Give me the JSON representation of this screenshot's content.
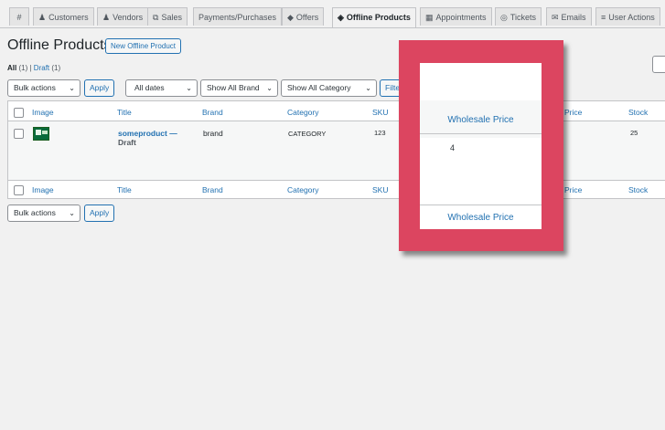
{
  "tabs": [
    {
      "icon": "#",
      "label": ""
    },
    {
      "icon": "♟",
      "label": "Customers"
    },
    {
      "icon": "♟",
      "label": "Vendors"
    },
    {
      "icon": "⧉",
      "label": "Sales"
    },
    {
      "icon": "",
      "label": "Payments/Purchases"
    },
    {
      "icon": "◆",
      "label": "Offers"
    },
    {
      "icon": "◈",
      "label": "Offline Products"
    },
    {
      "icon": "▦",
      "label": "Appointments"
    },
    {
      "icon": "◎",
      "label": "Tickets"
    },
    {
      "icon": "✉",
      "label": "Emails"
    },
    {
      "icon": "≡",
      "label": "User Actions"
    }
  ],
  "page": {
    "title": "Offline Products",
    "new_button": "New Offline Product",
    "filters": {
      "all_label": "All",
      "all_count": "(1)",
      "draft_label": "Draft",
      "draft_count": "(1)",
      "separator": "|"
    }
  },
  "controls": {
    "bulk_actions": "Bulk actions",
    "apply": "Apply",
    "dates": "All dates",
    "brand": "Show All Brand",
    "category": "Show All Category",
    "filter": "Filter"
  },
  "table": {
    "columns": [
      "Image",
      "Title",
      "Brand",
      "Category",
      "SKU",
      "Price",
      "Stock"
    ],
    "row": {
      "title": "someproduct",
      "dash": "—",
      "state": "Draft",
      "brand": "brand",
      "category": "CATEGORY",
      "sku": "123",
      "stock": "25"
    }
  },
  "highlight": {
    "header": "Wholesale Price",
    "value": "4",
    "footer": "Wholesale Price",
    "color": "#dc4560"
  }
}
